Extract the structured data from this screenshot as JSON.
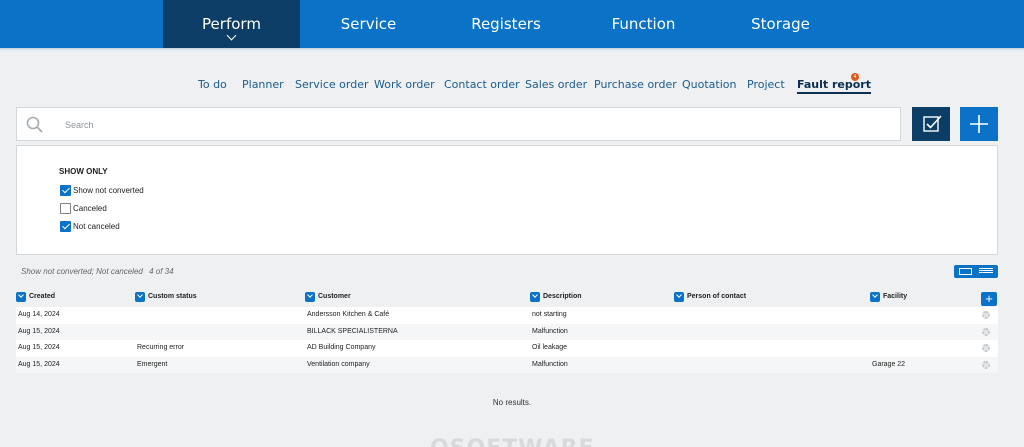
{
  "main_nav": {
    "tabs": [
      {
        "label": "Perform",
        "active": true
      },
      {
        "label": "Service",
        "active": false
      },
      {
        "label": "Registers",
        "active": false
      },
      {
        "label": "Function",
        "active": false
      },
      {
        "label": "Storage",
        "active": false
      }
    ]
  },
  "sub_nav": {
    "items": [
      {
        "label": "To do"
      },
      {
        "label": "Planner"
      },
      {
        "label": "Service order"
      },
      {
        "label": "Work order"
      },
      {
        "label": "Contact order"
      },
      {
        "label": "Sales order"
      },
      {
        "label": "Purchase order"
      },
      {
        "label": "Quotation"
      },
      {
        "label": "Project"
      },
      {
        "label": "Fault report",
        "active": true,
        "badge": "4"
      }
    ]
  },
  "search": {
    "placeholder": "Search",
    "value": "",
    "icon": "search-icon"
  },
  "toolbar": {
    "filter_icon": "checkbox-check-icon",
    "add_icon": "plus-icon"
  },
  "filters": {
    "heading": "SHOW ONLY",
    "options": [
      {
        "label": "Show not converted",
        "checked": true
      },
      {
        "label": "Canceled",
        "checked": false
      },
      {
        "label": "Not canceled",
        "checked": true
      }
    ]
  },
  "summary": {
    "text": "Show not converted; Not canceled",
    "count": "4 of 34"
  },
  "table": {
    "columns": [
      {
        "label": "Created"
      },
      {
        "label": "Custom status"
      },
      {
        "label": "Customer"
      },
      {
        "label": "Description"
      },
      {
        "label": "Person of contact"
      },
      {
        "label": "Facility"
      }
    ],
    "rows": [
      {
        "created": "Aug 14, 2024",
        "custom_status": "",
        "customer": "Andersson Kitchen & Café",
        "description": "not starting",
        "person_of_contact": "",
        "facility": ""
      },
      {
        "created": "Aug 15, 2024",
        "custom_status": "",
        "customer": "BILLACK SPECIALISTERNA",
        "description": "Malfunction",
        "person_of_contact": "",
        "facility": ""
      },
      {
        "created": "Aug 15, 2024",
        "custom_status": "Recurring error",
        "customer": "AD Building Company",
        "description": "Oil leakage",
        "person_of_contact": "",
        "facility": ""
      },
      {
        "created": "Aug 15, 2024",
        "custom_status": "Emergent",
        "customer": "Ventilation company",
        "description": "Malfunction",
        "person_of_contact": "",
        "facility": "Garage 22"
      }
    ]
  },
  "no_results": "No results.",
  "footer": {
    "logo_text": "OSOFTWARE"
  },
  "colors": {
    "primary": "#0a73c7",
    "primary_dark": "#0b3d66",
    "background": "#eef0f1",
    "badge": "#e05a1c"
  }
}
